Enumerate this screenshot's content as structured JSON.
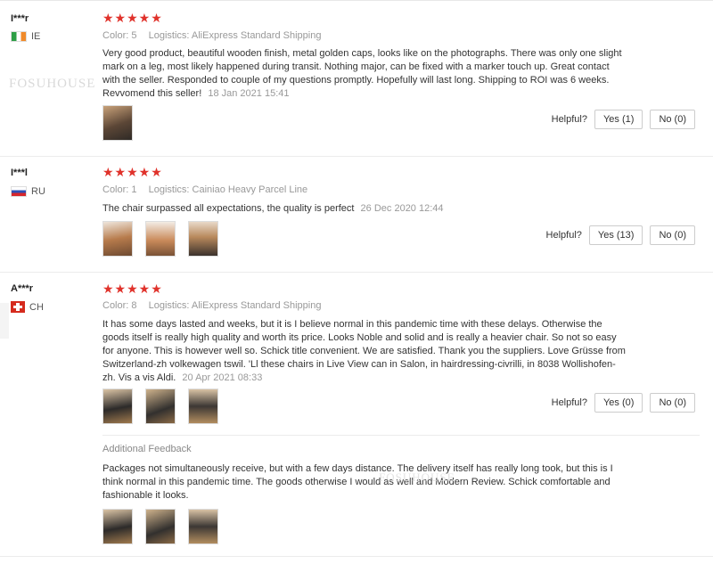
{
  "watermark": "FOSUHOUSE",
  "reviews": [
    {
      "user": "I***r",
      "country_code": "IE",
      "stars": "★★★★★",
      "color_label": "Color:",
      "color_value": "5",
      "logistics_label": "Logistics:",
      "logistics_value": "AliExpress Standard Shipping",
      "text": "Very good product, beautiful wooden finish, metal golden caps, looks like on the photographs. There was only one slight mark on a leg, most likely happened during transit. Nothing major, can be fixed with a marker touch up. Great contact with the seller. Responded to couple of my questions promptly. Hopefully will last long. Shipping to ROI was 6 weeks. Revvomend this seller!",
      "date": "18 Jan 2021 15:41",
      "helpful_label": "Helpful?",
      "yes_label": "Yes (1)",
      "no_label": "No (0)"
    },
    {
      "user": "I***l",
      "country_code": "RU",
      "stars": "★★★★★",
      "color_label": "Color:",
      "color_value": "1",
      "logistics_label": "Logistics:",
      "logistics_value": "Cainiao Heavy Parcel Line",
      "text": "The chair surpassed all expectations, the quality is perfect",
      "date": "26 Dec 2020 12:44",
      "helpful_label": "Helpful?",
      "yes_label": "Yes (13)",
      "no_label": "No (0)"
    },
    {
      "user": "A***r",
      "country_code": "CH",
      "stars": "★★★★★",
      "color_label": "Color:",
      "color_value": "8",
      "logistics_label": "Logistics:",
      "logistics_value": "AliExpress Standard Shipping",
      "text": "It has some days lasted and weeks, but it is I believe normal in this pandemic time with these delays. Otherwise the goods itself is really high quality and worth its price. Looks Noble and solid and is really a heavier chair. So not so easy for anyone. This is however well so. Schick title convenient. We are satisfied. Thank you the suppliers. Love Grüsse from Switzerland-zh volkewagen tswil. 'Ll these chairs in Live View can in Salon, in hairdressing-civrilli, in 8038 Wollishofen-zh. Vis a vis Aldi.",
      "date": "20 Apr 2021 08:33",
      "helpful_label": "Helpful?",
      "yes_label": "Yes (0)",
      "no_label": "No (0)",
      "additional_label": "Additional Feedback",
      "additional_text": "Packages not simultaneously receive, but with a few days distance. The delivery itself has really long took, but this is I think normal in this pandemic time. The goods otherwise I would as well and Modern Review. Schick comfortable and fashionable it looks."
    }
  ]
}
